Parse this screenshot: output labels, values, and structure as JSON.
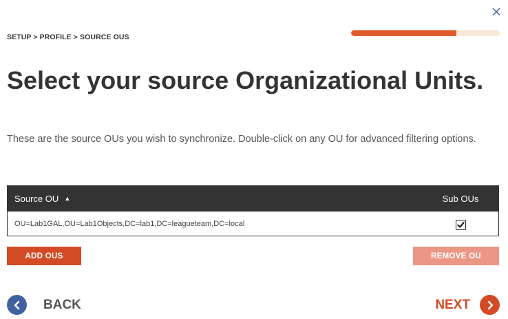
{
  "colors": {
    "accent": "#d34a24",
    "progress_fill": "#e05a2b",
    "progress_track": "#fbe6da",
    "header_bg": "#333333",
    "back_circle": "#41629f",
    "remove_disabled": "#ec9785"
  },
  "breadcrumb": "SETUP > PROFILE > SOURCE OUS",
  "progress": {
    "fraction": 0.71
  },
  "title": "Select your source Organizational Units.",
  "description": "These are the source OUs you wish to synchronize. Double-click on any OU for advanced filtering options.",
  "table": {
    "columns": {
      "source_ou": "Source OU",
      "sub_ous": "Sub OUs"
    },
    "sort_icon": "caret-up-icon",
    "rows": [
      {
        "source_ou": "OU=Lab1GAL,OU=Lab1Objects,DC=lab1,DC=leagueteam,DC=local",
        "sub_ous_checked": true
      }
    ]
  },
  "buttons": {
    "add": "ADD OUS",
    "remove": "REMOVE OU"
  },
  "nav": {
    "back": "BACK",
    "next": "NEXT"
  },
  "icons": {
    "close": "close-icon",
    "back": "chevron-left-icon",
    "next": "chevron-right-icon",
    "check": "checkmark-icon"
  }
}
